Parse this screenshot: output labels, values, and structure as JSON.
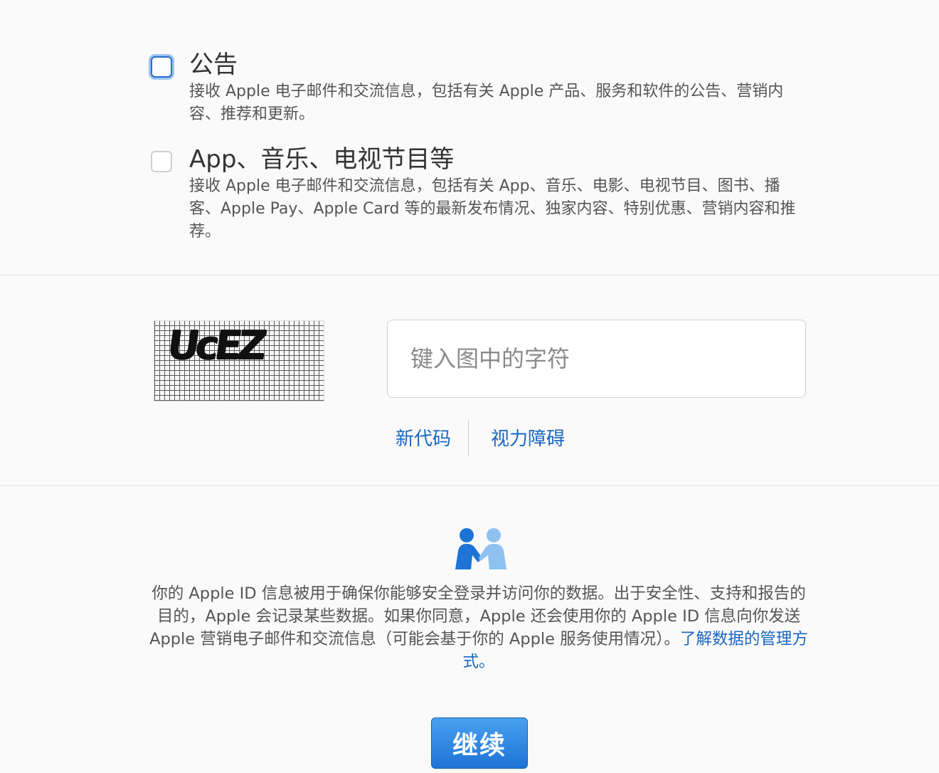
{
  "options": [
    {
      "title": "公告",
      "description": "接收 Apple 电子邮件和交流信息，包括有关 Apple 产品、服务和软件的公告、营销内容、推荐和更新。",
      "checked": false
    },
    {
      "title": "App、音乐、电视节目等",
      "description": "接收 Apple 电子邮件和交流信息，包括有关 App、音乐、电影、电视节目、图书、播客、Apple Pay、Apple Card 等的最新发布情况、独家内容、特别优惠、营销内容和推荐。",
      "checked": false
    }
  ],
  "captcha": {
    "image_text": "UcEZ",
    "input_placeholder": "键入图中的字符",
    "new_code_label": "新代码",
    "vision_impaired_label": "视力障碍"
  },
  "privacy": {
    "text": "你的 Apple ID 信息被用于确保你能够安全登录并访问你的数据。出于安全性、支持和报告的目的，Apple 会记录某些数据。如果你同意，Apple 还会使用你的 Apple ID 信息向你发送 Apple 营销电子邮件和交流信息（可能会基于你的 Apple 服务使用情况）。",
    "link_label": "了解数据的管理方式。"
  },
  "continue_label": "继续",
  "colors": {
    "link": "#1a66c2",
    "button": "#1d74d6",
    "focus": "#2a6cd1",
    "icon_person_dark": "#1d74d6",
    "icon_person_light": "#8ec1f0"
  },
  "icons": {
    "privacy": "handshake-people-icon"
  }
}
